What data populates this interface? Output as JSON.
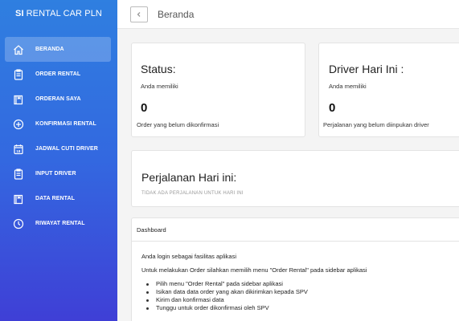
{
  "brand": {
    "bold": "SI",
    "rest": "RENTAL CAR PLN"
  },
  "sidebar": {
    "items": [
      {
        "label": "BERANDA",
        "icon": "home-icon",
        "active": true
      },
      {
        "label": "ORDER RENTAL",
        "icon": "clipboard-icon"
      },
      {
        "label": "ORDERAN SAYA",
        "icon": "book-icon"
      },
      {
        "label": "KONFIRMASI RENTAL",
        "icon": "plus-circle-icon"
      },
      {
        "label": "JADWAL CUTI DRIVER",
        "icon": "calendar-icon"
      },
      {
        "label": "INPUT DRIVER",
        "icon": "clipboard-icon"
      },
      {
        "label": "DATA RENTAL",
        "icon": "book-icon"
      },
      {
        "label": "RIWAYAT RENTAL",
        "icon": "clock-icon"
      }
    ]
  },
  "header": {
    "title": "Beranda"
  },
  "status_card": {
    "title": "Status:",
    "intro": "Anda memiliki",
    "count": "0",
    "caption": "Order yang belum dikonfirmasi"
  },
  "driver_card": {
    "title": "Driver Hari Ini :",
    "intro": "Anda memiliki",
    "count": "0",
    "caption": "Perjalanan yang belum diinpukan driver"
  },
  "trip_card": {
    "title": "Perjalanan Hari ini:",
    "empty": "TIDAK ADA PERJALANAN UNTUK HARI INI"
  },
  "dashboard": {
    "header": "Dashboard",
    "line1": "Anda login sebagai fasilitas aplikasi",
    "line2": "Untuk melakukan Order silahkan memilih menu \"Order Rental\" pada sidebar aplikasi",
    "steps": [
      "Pilih menu \"Order Rental\" pada sidebar aplikasi",
      "Isikan data data order yang akan dikirimkan kepada SPV",
      "Kirim dan konfirmasi data",
      "Tunggu untuk order dikonfirmasi oleh SPV"
    ]
  }
}
